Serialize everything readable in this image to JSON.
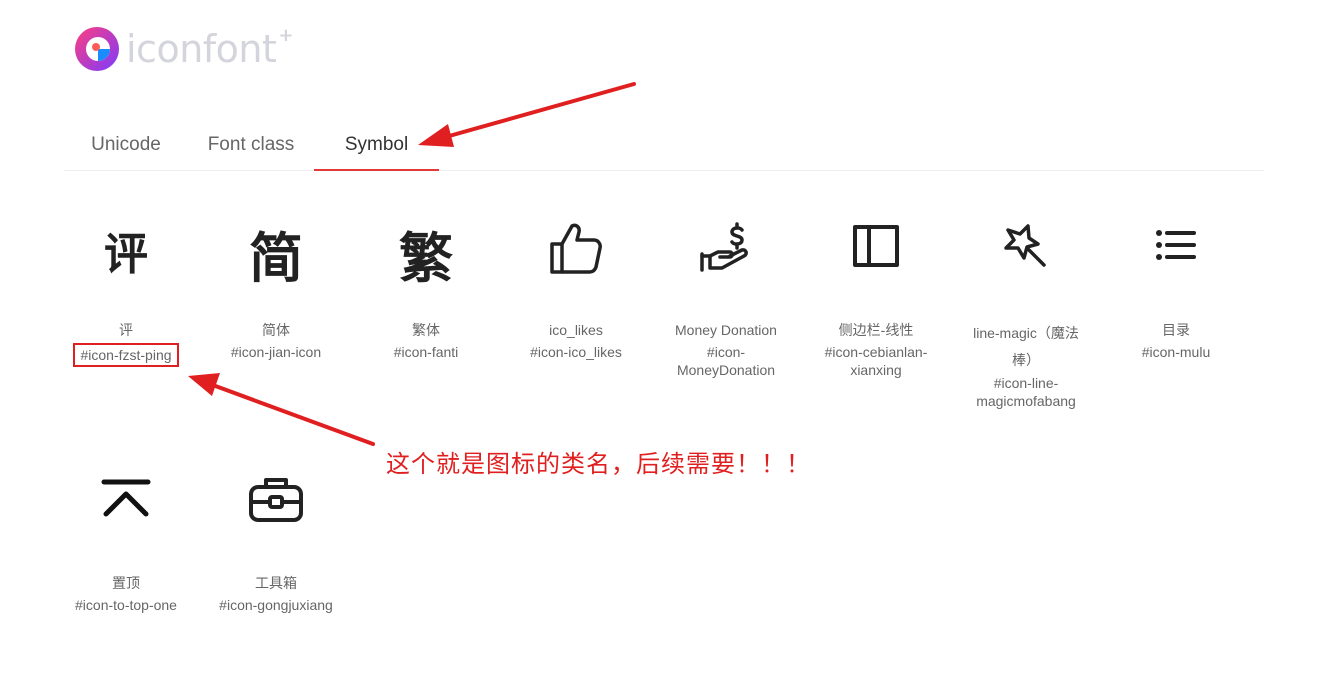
{
  "logo": {
    "text": "iconfont",
    "plus": "+"
  },
  "tabs": [
    {
      "label": "Unicode",
      "active": false
    },
    {
      "label": "Font class",
      "active": false
    },
    {
      "label": "Symbol",
      "active": true
    }
  ],
  "icons": [
    {
      "glyph": "评",
      "name": "评",
      "code": "#icon-fzst-ping",
      "highlighted": true
    },
    {
      "glyph": "简",
      "name": "简体",
      "code": "#icon-jian-icon"
    },
    {
      "glyph": "繁",
      "name": "繁体",
      "code": "#icon-fanti"
    },
    {
      "glyph": "thumbs-up-icon",
      "name": "ico_likes",
      "code": "#icon-ico_likes"
    },
    {
      "glyph": "money-donation-icon",
      "name": "Money Donation",
      "code_line1": "#icon-",
      "code_line2": "MoneyDonation"
    },
    {
      "glyph": "sidebar-icon",
      "name": "侧边栏-线性",
      "code_line1": "#icon-cebianlan-",
      "code_line2": "xianxing"
    },
    {
      "glyph": "magic-wand-icon",
      "name_line1": "line-magic（魔法",
      "name_line2": "棒）",
      "code_line1": "#icon-line-",
      "code_line2": "magicmofabang"
    },
    {
      "glyph": "list-icon",
      "name": "目录",
      "code": "#icon-mulu"
    },
    {
      "glyph": "to-top-icon",
      "name": "置顶",
      "code": "#icon-to-top-one"
    },
    {
      "glyph": "toolbox-icon",
      "name": "工具箱",
      "code": "#icon-gongjuxiang"
    }
  ],
  "annotation": {
    "text": "这个就是图标的类名，后续需要！！！",
    "color": "#e02020"
  },
  "colors": {
    "accent": "#e4393c",
    "annotation": "#e02020",
    "logo_gradient_start": "#ff3d7f",
    "logo_gradient_end": "#7b3cff"
  }
}
